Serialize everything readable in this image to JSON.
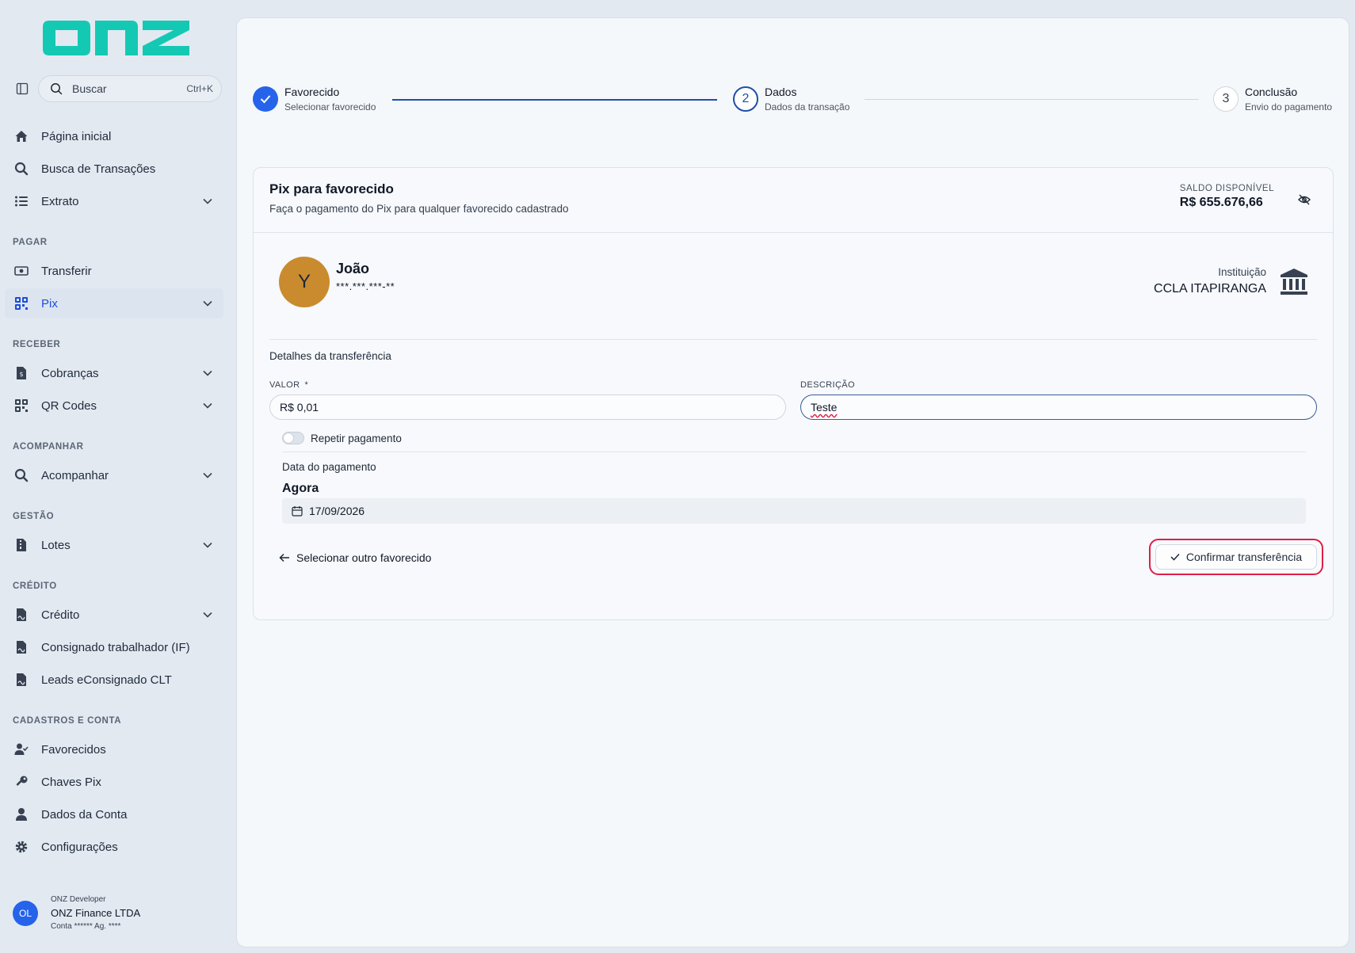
{
  "brand": {
    "logo_text": "onz",
    "logo_color": "#14c9b4"
  },
  "search": {
    "placeholder": "Buscar",
    "shortcut": "Ctrl+K"
  },
  "sidebar": {
    "items": [
      {
        "label": "Página inicial"
      },
      {
        "label": "Busca de Transações"
      },
      {
        "label": "Extrato"
      },
      {
        "label": "Transferir"
      },
      {
        "label": "Pix"
      },
      {
        "label": "Cobranças"
      },
      {
        "label": "QR Codes"
      },
      {
        "label": "Acompanhar"
      },
      {
        "label": "Lotes"
      },
      {
        "label": "Crédito"
      },
      {
        "label": "Consignado trabalhador (IF)"
      },
      {
        "label": "Leads eConsignado CLT"
      },
      {
        "label": "Favorecidos"
      },
      {
        "label": "Chaves Pix"
      },
      {
        "label": "Dados da Conta"
      },
      {
        "label": "Configurações"
      }
    ],
    "sections": {
      "pagar": "PAGAR",
      "receber": "RECEBER",
      "acompanhar": "ACOMPANHAR",
      "gestao": "GESTÃO",
      "credito": "CRÉDITO",
      "cadastros": "CADASTROS E CONTA"
    }
  },
  "user": {
    "initials": "OL",
    "role": "ONZ Developer",
    "company": "ONZ Finance LTDA",
    "account": "Conta ****** Ag. ****"
  },
  "stepper": {
    "steps": [
      {
        "title": "Favorecido",
        "subtitle": "Selecionar favorecido",
        "number": ""
      },
      {
        "title": "Dados",
        "subtitle": "Dados da transação",
        "number": "2"
      },
      {
        "title": "Conclusão",
        "subtitle": "Envio do pagamento",
        "number": "3"
      }
    ]
  },
  "card": {
    "title": "Pix para favorecido",
    "subtitle": "Faça o pagamento do Pix para qualquer favorecido cadastrado",
    "balance_label": "SALDO DISPONÍVEL",
    "balance_value": "R$ 655.676,66"
  },
  "payee": {
    "initial": "Y",
    "name": "João",
    "document": "***.***.***-**",
    "institution_label": "Instituição",
    "institution_name": "CCLA ITAPIRANGA"
  },
  "form": {
    "section_title": "Detalhes da transferência",
    "valor_label": "VALOR",
    "valor_required": "*",
    "valor_value": "R$ 0,01",
    "descricao_label": "DESCRIÇÃO",
    "descricao_value": "Teste",
    "repeat_label": "Repetir pagamento",
    "date_label": "Data do pagamento",
    "date_mode": "Agora",
    "date_value": "17/09/2026"
  },
  "actions": {
    "back_label": "Selecionar outro favorecido",
    "confirm_label": "Confirmar transferência"
  },
  "colors": {
    "accent": "#2563eb",
    "highlight": "#e11d48",
    "payee_avatar": "#c98b2e"
  }
}
